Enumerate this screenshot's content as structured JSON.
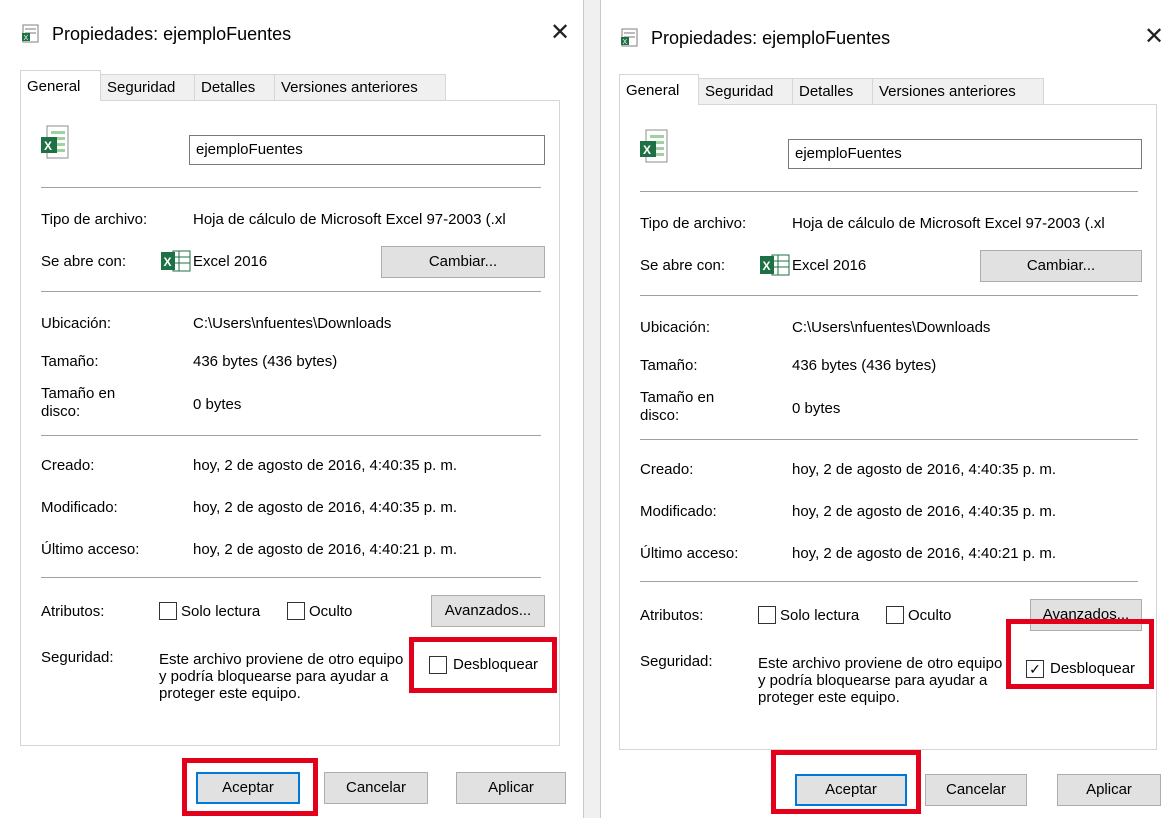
{
  "dialogs": [
    {
      "title": "Propiedades: ejemploFuentes",
      "close_glyph": "✕",
      "tabs": [
        "General",
        "Seguridad",
        "Detalles",
        "Versiones anteriores"
      ],
      "filename": "ejemploFuentes",
      "type_label": "Tipo de archivo:",
      "type_value": "Hoja de cálculo de Microsoft Excel 97-2003 (.xl",
      "opens_label": "Se abre con:",
      "opens_value": "Excel 2016",
      "change_btn": "Cambiar...",
      "location_label": "Ubicación:",
      "location_value": "C:\\Users\\nfuentes\\Downloads",
      "size_label": "Tamaño:",
      "size_value": "436 bytes (436 bytes)",
      "disk_label_1": "Tamaño en",
      "disk_label_2": "disco:",
      "disk_value": "0 bytes",
      "created_label": "Creado:",
      "created_value": "hoy, 2 de agosto de 2016, 4:40:35 p. m.",
      "modified_label": "Modificado:",
      "modified_value": "hoy, 2 de agosto de 2016, 4:40:35 p. m.",
      "accessed_label": "Último acceso:",
      "accessed_value": "hoy, 2 de agosto de 2016, 4:40:21 p. m.",
      "attrs_label": "Atributos:",
      "readonly_label": "Solo lectura",
      "hidden_label": "Oculto",
      "advanced_btn": "Avanzados...",
      "security_label": "Seguridad:",
      "security_text": "Este archivo proviene de otro equipo y podría bloquearse para ayudar a proteger este equipo.",
      "unblock_label": "Desbloquear",
      "unblock_checked": false,
      "unblock_mark": "",
      "ok_btn": "Aceptar",
      "cancel_btn": "Cancelar",
      "apply_btn": "Aplicar"
    },
    {
      "title": "Propiedades: ejemploFuentes",
      "close_glyph": "✕",
      "tabs": [
        "General",
        "Seguridad",
        "Detalles",
        "Versiones anteriores"
      ],
      "filename": "ejemploFuentes",
      "type_label": "Tipo de archivo:",
      "type_value": "Hoja de cálculo de Microsoft Excel 97-2003 (.xl",
      "opens_label": "Se abre con:",
      "opens_value": "Excel 2016",
      "change_btn": "Cambiar...",
      "location_label": "Ubicación:",
      "location_value": "C:\\Users\\nfuentes\\Downloads",
      "size_label": "Tamaño:",
      "size_value": "436 bytes (436 bytes)",
      "disk_label_1": "Tamaño en",
      "disk_label_2": "disco:",
      "disk_value": "0 bytes",
      "created_label": "Creado:",
      "created_value": "hoy, 2 de agosto de 2016, 4:40:35 p. m.",
      "modified_label": "Modificado:",
      "modified_value": "hoy, 2 de agosto de 2016, 4:40:35 p. m.",
      "accessed_label": "Último acceso:",
      "accessed_value": "hoy, 2 de agosto de 2016, 4:40:21 p. m.",
      "attrs_label": "Atributos:",
      "readonly_label": "Solo lectura",
      "hidden_label": "Oculto",
      "advanced_btn": "Avanzados...",
      "security_label": "Seguridad:",
      "security_text": "Este archivo proviene de otro equipo y podría bloquearse para ayudar a proteger este equipo.",
      "unblock_label": "Desbloquear",
      "unblock_checked": true,
      "unblock_mark": "✓",
      "ok_btn": "Aceptar",
      "cancel_btn": "Cancelar",
      "apply_btn": "Aplicar"
    }
  ],
  "colors": {
    "highlight": "#e3001b",
    "default_button_border": "#0078d7",
    "excel_green": "#1e7145"
  },
  "icons": {
    "title": "excel-document-icon",
    "close": "close-icon",
    "app": "excel-app-icon"
  }
}
